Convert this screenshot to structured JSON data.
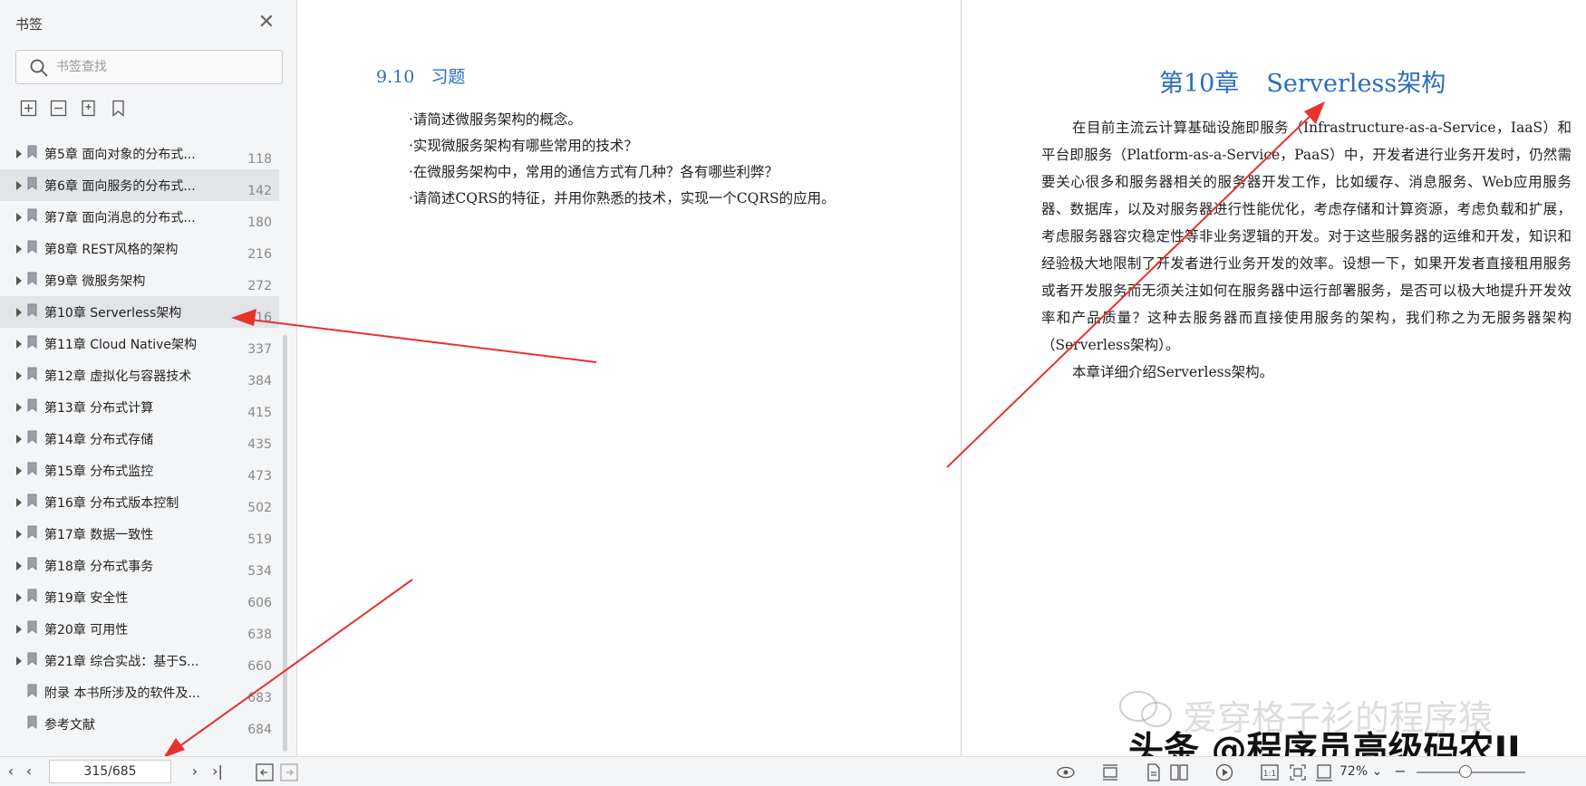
{
  "sidebar": {
    "title": "书签",
    "search_placeholder": "书签查找",
    "tools": [
      "expand-all-icon",
      "collapse-all-icon",
      "add-bookmark-icon",
      "bookmark-icon"
    ],
    "items": [
      {
        "label": "第5章 面向对象的分布式...",
        "page": "118",
        "expandable": true,
        "selected": false
      },
      {
        "label": "第6章 面向服务的分布式...",
        "page": "142",
        "expandable": true,
        "selected": true
      },
      {
        "label": "第7章 面向消息的分布式...",
        "page": "180",
        "expandable": true,
        "selected": false
      },
      {
        "label": "第8章 REST风格的架构",
        "page": "216",
        "expandable": true,
        "selected": false
      },
      {
        "label": "第9章 微服务架构",
        "page": "272",
        "expandable": true,
        "selected": false
      },
      {
        "label": "第10章 Serverless架构",
        "page": "316",
        "expandable": true,
        "selected": true
      },
      {
        "label": "第11章 Cloud Native架构",
        "page": "337",
        "expandable": true,
        "selected": false
      },
      {
        "label": "第12章 虚拟化与容器技术",
        "page": "384",
        "expandable": true,
        "selected": false
      },
      {
        "label": "第13章 分布式计算",
        "page": "415",
        "expandable": true,
        "selected": false
      },
      {
        "label": "第14章 分布式存储",
        "page": "435",
        "expandable": true,
        "selected": false
      },
      {
        "label": "第15章 分布式监控",
        "page": "473",
        "expandable": true,
        "selected": false
      },
      {
        "label": "第16章 分布式版本控制",
        "page": "502",
        "expandable": true,
        "selected": false
      },
      {
        "label": "第17章 数据一致性",
        "page": "519",
        "expandable": true,
        "selected": false
      },
      {
        "label": "第18章 分布式事务",
        "page": "534",
        "expandable": true,
        "selected": false
      },
      {
        "label": "第19章 安全性",
        "page": "606",
        "expandable": true,
        "selected": false
      },
      {
        "label": "第20章 可用性",
        "page": "638",
        "expandable": true,
        "selected": false
      },
      {
        "label": "第21章 综合实战：基于S...",
        "page": "660",
        "expandable": true,
        "selected": false
      },
      {
        "label": "附录 本书所涉及的软件及...",
        "page": "683",
        "expandable": false,
        "selected": false
      },
      {
        "label": "参考文献",
        "page": "684",
        "expandable": false,
        "selected": false
      }
    ]
  },
  "left_page": {
    "heading_number": "9.10",
    "heading_text": "习题",
    "exercises": [
      "·请简述微服务架构的概念。",
      "·实现微服务架构有哪些常用的技术？",
      "·在微服务架构中，常用的通信方式有几种？各有哪些利弊？",
      "·请简述CQRS的特征，并用你熟悉的技术，实现一个CQRS的应用。"
    ]
  },
  "right_page": {
    "chapter_number": "第10章",
    "chapter_title": "Serverless架构",
    "paragraphs": [
      "在目前主流云计算基础设施即服务（Infrastructure-as-a-Service，IaaS）和平台即服务（Platform-as-a-Service，PaaS）中，开发者进行业务开发时，仍然需要关心很多和服务器相关的服务器开发工作，比如缓存、消息服务、Web应用服务器、数据库，以及对服务器进行性能优化，考虑存储和计算资源，考虑负载和扩展，考虑服务器容灾稳定性等非业务逻辑的开发。对于这些服务器的运维和开发，知识和经验极大地限制了开发者进行业务开发的效率。设想一下，如果开发者直接租用服务或者开发服务而无须关注如何在服务器中运行部署服务，是否可以极大地提升开发效率和产品质量？这种去服务器而直接使用服务的架构，我们称之为无服务器架构（Serverless架构）。",
      "本章详细介绍Serverless架构。"
    ]
  },
  "watermark": {
    "line1": "爱穿格子衫的程序猿",
    "line2": "头条 @程序员高级码农II"
  },
  "toolbar": {
    "page_value": "315/685",
    "zoom": "72%",
    "zoom_level": 0.45,
    "prev_icon": "chevron-left-icon",
    "next_icon": "chevron-right-icon"
  },
  "colors": {
    "accent": "#2a6ebb",
    "arrow": "#e8322c"
  }
}
